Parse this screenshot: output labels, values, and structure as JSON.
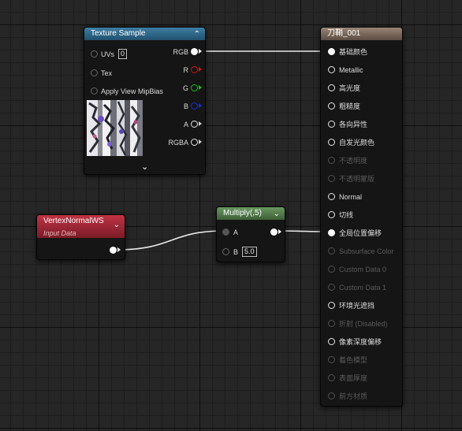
{
  "texture_sample": {
    "title": "Texture Sample",
    "inputs": {
      "uvs": "UVs",
      "uvs_value": "0",
      "tex": "Tex",
      "apply_view_mip_bias": "Apply View MipBias"
    },
    "outputs": {
      "rgb": "RGB",
      "r": "R",
      "g": "G",
      "b": "B",
      "a": "A",
      "rgba": "RGBA"
    }
  },
  "vertex_normal": {
    "title": "VertexNormalWS",
    "subtitle": "Input Data"
  },
  "multiply": {
    "title": "Multiply(,5)",
    "input_a": "A",
    "input_b": "B",
    "b_value": "5.0"
  },
  "material": {
    "title": "刀鞘_001",
    "pins": [
      {
        "label": "基础颜色"
      },
      {
        "label": "Metallic"
      },
      {
        "label": "高光度"
      },
      {
        "label": "粗糙度"
      },
      {
        "label": "各向异性"
      },
      {
        "label": "自发光颜色"
      },
      {
        "label": "不透明度"
      },
      {
        "label": "不透明蒙版"
      },
      {
        "label": "Normal"
      },
      {
        "label": "切线"
      },
      {
        "label": "全局位置偏移"
      },
      {
        "label": "Subsurface Color"
      },
      {
        "label": "Custom Data 0"
      },
      {
        "label": "Custom Data 1"
      },
      {
        "label": "环境光遮挡"
      },
      {
        "label": "折射 (Disabled)"
      },
      {
        "label": "像素深度偏移"
      },
      {
        "label": "着色模型"
      },
      {
        "label": "表面厚度"
      },
      {
        "label": "前方材质"
      }
    ]
  },
  "colors": {
    "wire": "#e8e8e8",
    "pin_r": "#d01414",
    "pin_g": "#16c016",
    "pin_b": "#1a2ee0"
  }
}
